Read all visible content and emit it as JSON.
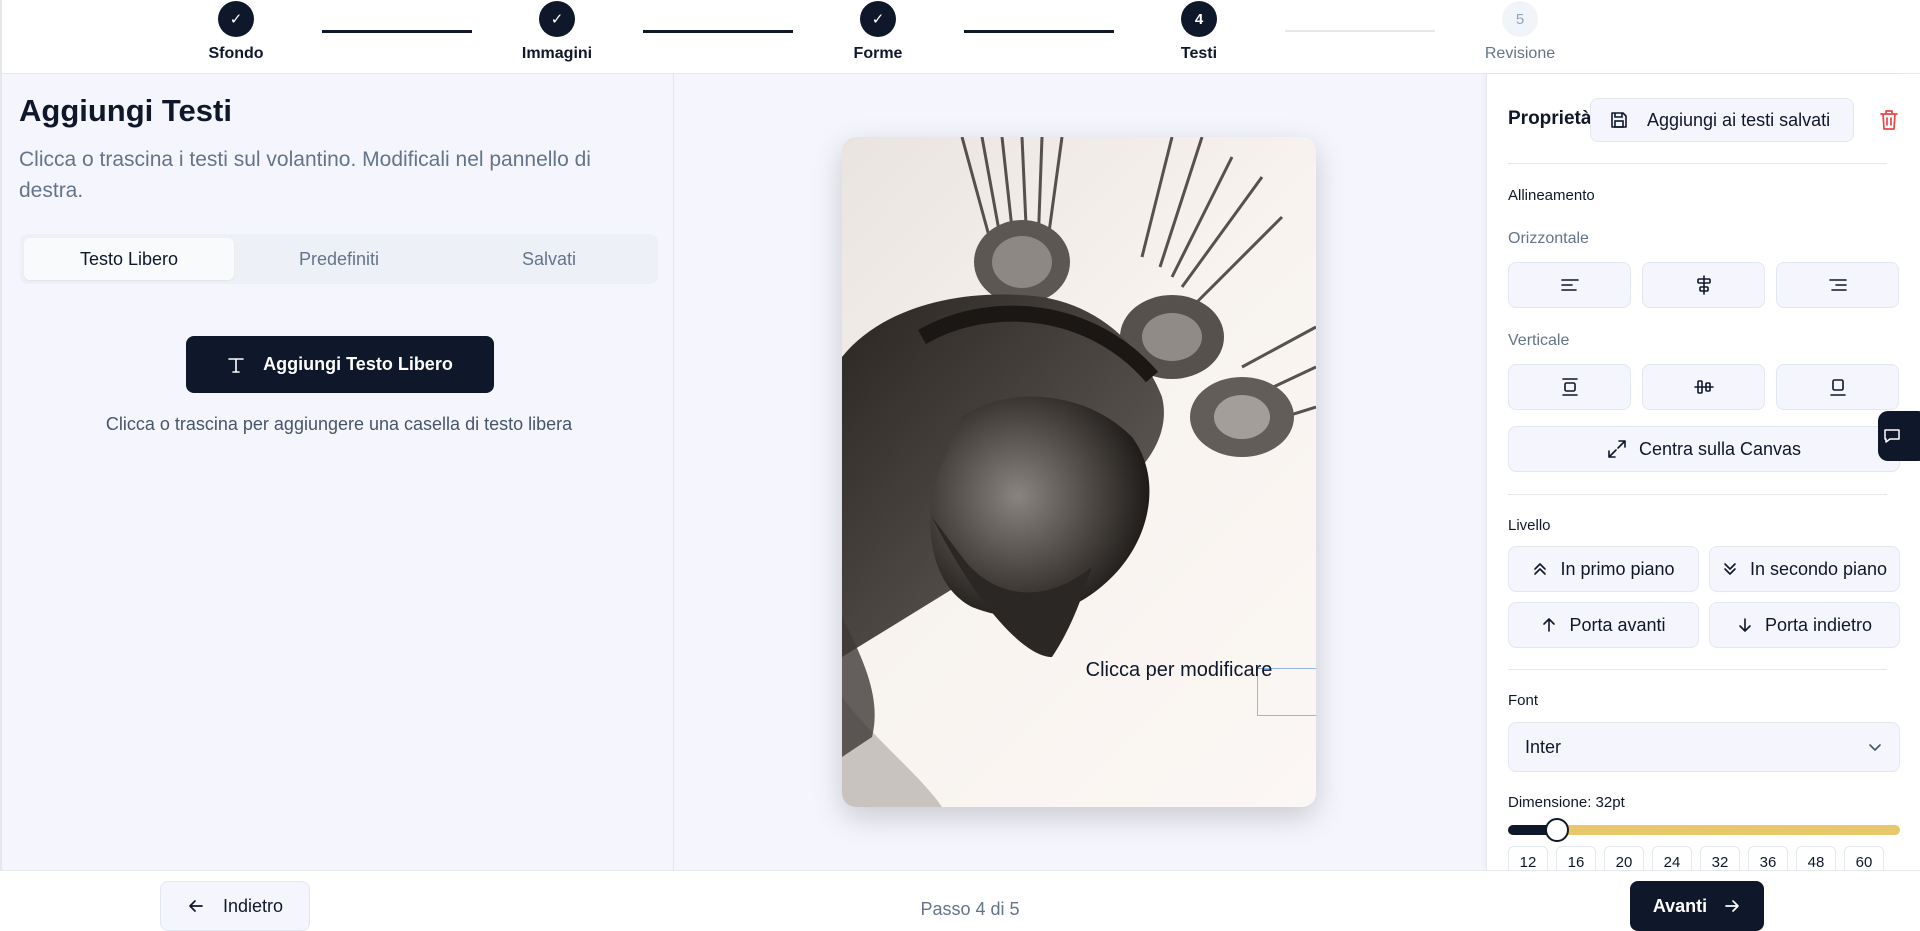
{
  "stepper": {
    "steps": [
      {
        "label": "Sfondo",
        "state": "done",
        "badge": "✓"
      },
      {
        "label": "Immagini",
        "state": "done",
        "badge": "✓"
      },
      {
        "label": "Forme",
        "state": "done",
        "badge": "✓"
      },
      {
        "label": "Testi",
        "state": "current",
        "badge": "4"
      },
      {
        "label": "Revisione",
        "state": "pending",
        "badge": "5"
      }
    ]
  },
  "left": {
    "title": "Aggiungi Testi",
    "description": "Clicca o trascina i testi sul volantino. Modificali nel pannello di destra.",
    "tabs": [
      "Testo Libero",
      "Predefiniti",
      "Salvati"
    ],
    "active_tab": "Testo Libero",
    "add_button": "Aggiungi Testo Libero",
    "hint": "Clicca o trascina per aggiungere una casella di testo libera"
  },
  "canvas": {
    "selected_text": "Clicca per modificare"
  },
  "properties": {
    "title": "Proprietà",
    "save_button": "Aggiungi ai testi salvati",
    "alignment_label": "Allineamento",
    "horizontal_label": "Orizzontale",
    "vertical_label": "Verticale",
    "center_button": "Centra sulla Canvas",
    "layer_label": "Livello",
    "layer_buttons": [
      "In primo piano",
      "In secondo piano",
      "Porta avanti",
      "Porta indietro"
    ],
    "font_label": "Font",
    "font_value": "Inter",
    "size_label": "Dimensione: 32pt",
    "size_value": 32,
    "size_min": 8,
    "size_max": 200,
    "size_presets": [
      "12",
      "16",
      "20",
      "24",
      "32",
      "36",
      "48",
      "60"
    ]
  },
  "footer": {
    "back": "Indietro",
    "step_count": "Passo 4 di 5",
    "next": "Avanti"
  },
  "colors": {
    "primary": "#0f172a",
    "slider_track": "#e8c66a",
    "danger": "#ef4444",
    "selection": "#93b4f5"
  }
}
